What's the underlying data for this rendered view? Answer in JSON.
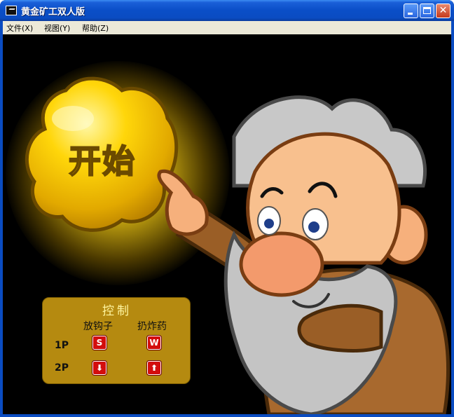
{
  "window": {
    "title": "黄金矿工双人版",
    "min_label": "",
    "max_label": "",
    "close_label": "✕"
  },
  "menu": {
    "items": [
      {
        "label": "文件(X)"
      },
      {
        "label": "视图(Y)"
      },
      {
        "label": "帮助(Z)"
      }
    ]
  },
  "game": {
    "start_label": "开始",
    "controls": {
      "title": "控制",
      "hook_header": "放钩子",
      "bomb_header": "扔炸药",
      "rows": [
        {
          "player": "1P",
          "hook_key": "S",
          "bomb_key": "W"
        },
        {
          "player": "2P",
          "hook_key": "⬇",
          "bomb_key": "⬆"
        }
      ]
    }
  },
  "colors": {
    "titlebar": "#0a4cc2",
    "menubar": "#ece9d8",
    "game_bg": "#000000",
    "gold": "#f2c500",
    "panel": "#b58a10",
    "key": "#d30d0d"
  },
  "icons": {
    "app": "game-app-icon",
    "minimize": "minimize-icon",
    "maximize": "maximize-icon",
    "close": "close-icon"
  }
}
